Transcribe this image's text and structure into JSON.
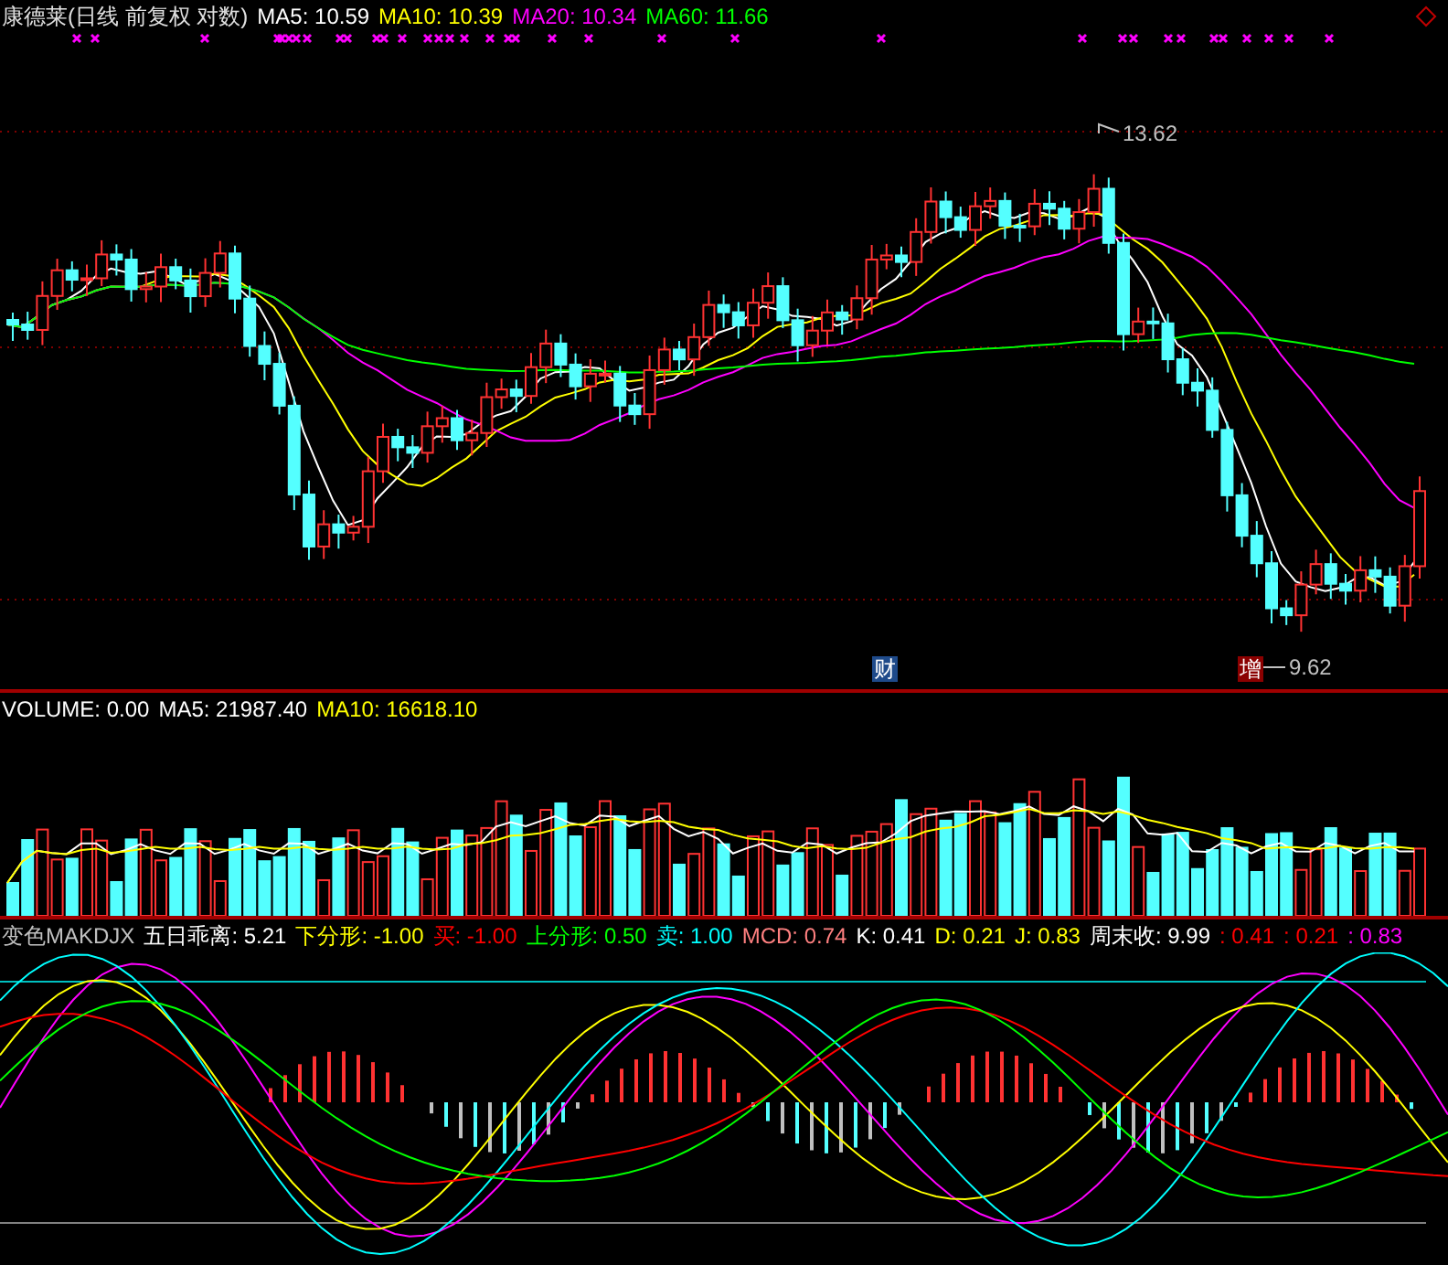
{
  "price_panel": {
    "title": "康德莱(日线 前复权 对数)",
    "indicators": [
      {
        "label": "MA5: 10.59",
        "color": "#ffffff"
      },
      {
        "label": "MA10: 10.39",
        "color": "#ffff00"
      },
      {
        "label": "MA20: 10.34",
        "color": "#ff00ff"
      },
      {
        "label": "MA60: 11.66",
        "color": "#00ff00"
      }
    ],
    "high_label": "13.62",
    "low_label": "9.62",
    "badges": [
      {
        "text": "财",
        "kind": "finance"
      },
      {
        "text": "增",
        "kind": "increase"
      }
    ]
  },
  "volume_panel": {
    "indicators": [
      {
        "label": "VOLUME: 0.00",
        "color": "#ffffff"
      },
      {
        "label": "MA5: 21987.40",
        "color": "#ffffff"
      },
      {
        "label": "MA10: 16618.10",
        "color": "#ffff00"
      }
    ]
  },
  "indicator_panel": {
    "indicators": [
      {
        "label": "变色MAKDJX",
        "color": "#c0c0c0"
      },
      {
        "label": "五日乖离: 5.21",
        "color": "#ffffff"
      },
      {
        "label": "下分形: -1.00",
        "color": "#ffff00"
      },
      {
        "label": "买: -1.00",
        "color": "#ff0000"
      },
      {
        "label": "上分形: 0.50",
        "color": "#00ff00"
      },
      {
        "label": "卖: 1.00",
        "color": "#00ffff"
      },
      {
        "label": "MCD: 0.74",
        "color": "#ff8080"
      },
      {
        "label": "K: 0.41",
        "color": "#ffffff"
      },
      {
        "label": "D: 0.21",
        "color": "#ffff00"
      },
      {
        "label": "J: 0.83",
        "color": "#ffff00"
      },
      {
        "label": "周末收: 9.99",
        "color": "#ffffff"
      },
      {
        "label": ": 0.41",
        "color": "#ff0000"
      },
      {
        "label": ": 0.21",
        "color": "#ff0000"
      },
      {
        "label": ": 0.83",
        "color": "#ff00ff"
      }
    ]
  }
}
